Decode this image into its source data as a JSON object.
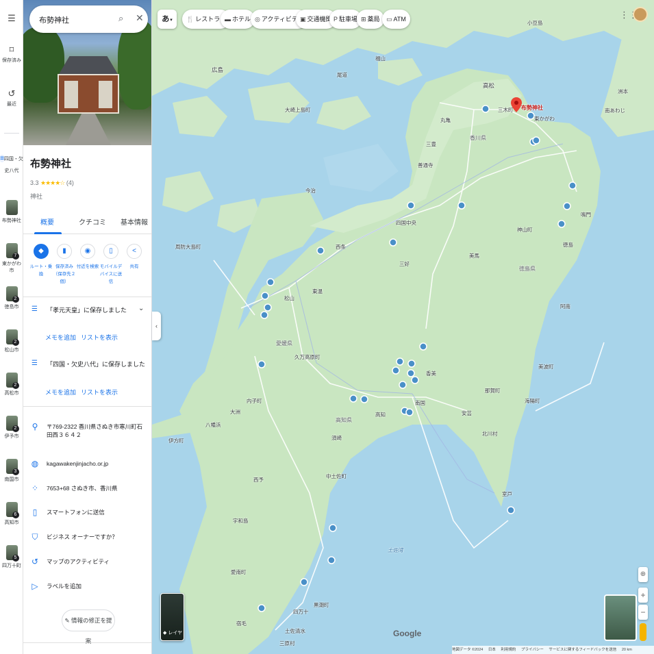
{
  "rail": {
    "menu_icon": "menu-icon",
    "saved_label": "保存済み",
    "recent_label": "最近",
    "items": [
      {
        "label": "四国・欠史八代",
        "badge": ""
      },
      {
        "label": "布勢神社",
        "badge": ""
      },
      {
        "label": "東かがわ市",
        "badge": "7"
      },
      {
        "label": "徳島市",
        "badge": "2"
      },
      {
        "label": "松山市",
        "badge": "2"
      },
      {
        "label": "高松市",
        "badge": "2"
      },
      {
        "label": "伊予市",
        "badge": "2"
      },
      {
        "label": "南国市",
        "badge": "3"
      },
      {
        "label": "高知市",
        "badge": "6"
      },
      {
        "label": "四万十町",
        "badge": "5"
      }
    ]
  },
  "search": {
    "query": "布勢神社"
  },
  "place": {
    "name": "布勢神社",
    "rating": "3.3",
    "stars": "★★★★☆",
    "review_count": "(4)",
    "category": "神社"
  },
  "tabs": [
    {
      "label": "概要"
    },
    {
      "label": "クチコミ"
    },
    {
      "label": "基本情報"
    }
  ],
  "actions": [
    {
      "label": "ルート・乗換",
      "icon": "directions-icon"
    },
    {
      "label": "保存済み（保存先２個）",
      "icon": "bookmark-icon"
    },
    {
      "label": "付近を検索",
      "icon": "nearby-icon"
    },
    {
      "label": "モバイルデバイスに送信",
      "icon": "phone-icon"
    },
    {
      "label": "共有",
      "icon": "share-icon"
    }
  ],
  "saved_lists": [
    {
      "text": "「孝元天皇」に保存しました",
      "memo": "メモを追加",
      "show": "リストを表示"
    },
    {
      "text": "「四国・欠史八代」に保存しました",
      "memo": "メモを追加",
      "show": "リストを表示"
    }
  ],
  "info": [
    {
      "icon": "location-pin-icon",
      "text": "〒769-2322 香川県さぬき市寒川町石田西３６４２"
    },
    {
      "icon": "globe-icon",
      "text": "kagawakenjinjacho.or.jp"
    },
    {
      "icon": "plus-code-icon",
      "text": "7653+68 さぬき市、香川県"
    },
    {
      "icon": "send-to-phone-icon",
      "text": "スマートフォンに送信"
    },
    {
      "icon": "verified-icon",
      "text": "ビジネス オーナーですか？"
    },
    {
      "icon": "history-icon",
      "text": "マップのアクティビティ"
    },
    {
      "icon": "label-icon",
      "text": "ラベルを追加"
    }
  ],
  "suggest_edit": "情報の修正を提案",
  "chips": [
    {
      "label": "あ"
    },
    {
      "label": "レストラン",
      "icon": "restaurant-icon"
    },
    {
      "label": "ホテル",
      "icon": "hotel-icon"
    },
    {
      "label": "アクティビティ",
      "icon": "activity-icon"
    },
    {
      "label": "交通機関",
      "icon": "transit-icon"
    },
    {
      "label": "駐車場",
      "icon": "parking-icon"
    },
    {
      "label": "薬局",
      "icon": "pharmacy-icon"
    },
    {
      "label": "ATM",
      "icon": "atm-icon"
    }
  ],
  "layer_label": "レイヤ",
  "pin_label": "布勢神社",
  "map_labels": [
    {
      "text": "広島",
      "cls": "city"
    },
    {
      "text": "高松",
      "cls": "city"
    },
    {
      "text": "香川県",
      "cls": "pref"
    },
    {
      "text": "東かがわ",
      "cls": ""
    },
    {
      "text": "三木町",
      "cls": ""
    },
    {
      "text": "丸亀",
      "cls": ""
    },
    {
      "text": "善通寺",
      "cls": ""
    },
    {
      "text": "三豊",
      "cls": ""
    },
    {
      "text": "四国中央",
      "cls": ""
    },
    {
      "text": "西条",
      "cls": ""
    },
    {
      "text": "今治",
      "cls": ""
    },
    {
      "text": "松山",
      "cls": ""
    },
    {
      "text": "東温",
      "cls": ""
    },
    {
      "text": "愛媛県",
      "cls": "pref"
    },
    {
      "text": "久万高原町",
      "cls": ""
    },
    {
      "text": "内子町",
      "cls": ""
    },
    {
      "text": "大洲",
      "cls": ""
    },
    {
      "text": "八幡浜",
      "cls": ""
    },
    {
      "text": "伊方町",
      "cls": ""
    },
    {
      "text": "西予",
      "cls": ""
    },
    {
      "text": "宇和島",
      "cls": ""
    },
    {
      "text": "愛南町",
      "cls": ""
    },
    {
      "text": "宿毛",
      "cls": ""
    },
    {
      "text": "四万十",
      "cls": ""
    },
    {
      "text": "黒潮町",
      "cls": ""
    },
    {
      "text": "土佐清水",
      "cls": ""
    },
    {
      "text": "三原村",
      "cls": ""
    },
    {
      "text": "中土佐町",
      "cls": ""
    },
    {
      "text": "須崎",
      "cls": ""
    },
    {
      "text": "高知県",
      "cls": "pref"
    },
    {
      "text": "高知",
      "cls": ""
    },
    {
      "text": "南国",
      "cls": ""
    },
    {
      "text": "香美",
      "cls": ""
    },
    {
      "text": "安芸",
      "cls": ""
    },
    {
      "text": "北川村",
      "cls": ""
    },
    {
      "text": "室戸",
      "cls": ""
    },
    {
      "text": "徳島県",
      "cls": "pref"
    },
    {
      "text": "徳島",
      "cls": ""
    },
    {
      "text": "阿南",
      "cls": ""
    },
    {
      "text": "美馬",
      "cls": ""
    },
    {
      "text": "三好",
      "cls": ""
    },
    {
      "text": "神山町",
      "cls": ""
    },
    {
      "text": "那賀町",
      "cls": ""
    },
    {
      "text": "美波町",
      "cls": ""
    },
    {
      "text": "海陽町",
      "cls": ""
    },
    {
      "text": "鳴門",
      "cls": ""
    },
    {
      "text": "南あわじ",
      "cls": ""
    },
    {
      "text": "洲本",
      "cls": ""
    },
    {
      "text": "土佐湾",
      "cls": "sea"
    },
    {
      "text": "周防大島町",
      "cls": ""
    },
    {
      "text": "大崎上島町",
      "cls": ""
    },
    {
      "text": "尾道",
      "cls": ""
    },
    {
      "text": "福山",
      "cls": ""
    },
    {
      "text": "小豆島",
      "cls": ""
    }
  ],
  "google_logo": "Google",
  "footer": [
    "地図データ ©2024",
    "日本",
    "利用規約",
    "プライバシー",
    "サービスに関するフィードバックを送信",
    "20 km"
  ]
}
